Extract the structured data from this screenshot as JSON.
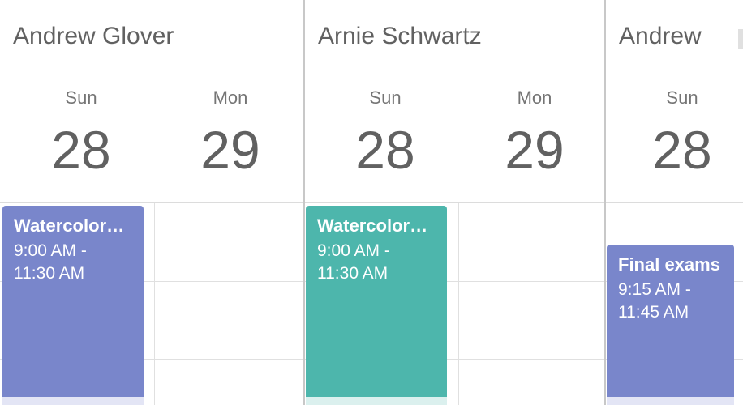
{
  "resources": [
    {
      "name": "Andrew Glover"
    },
    {
      "name": "Arnie Schwartz"
    },
    {
      "name": "Andrew"
    }
  ],
  "days": [
    {
      "day": "Sun",
      "date": "28"
    },
    {
      "day": "Mon",
      "date": "29"
    },
    {
      "day": "Sun",
      "date": "28"
    },
    {
      "day": "Mon",
      "date": "29"
    },
    {
      "day": "Sun",
      "date": "28"
    }
  ],
  "appointments": [
    {
      "title": "Watercolor…",
      "start": "9:00 AM  -",
      "end": "11:30 AM",
      "color": "#7986cb"
    },
    {
      "title": "Watercolor…",
      "start": "9:00 AM  -",
      "end": "11:30 AM",
      "color": "#4db6ac"
    },
    {
      "title": "Final exams",
      "start": "9:15 AM  -",
      "end": "11:45 AM",
      "color": "#7986cb"
    }
  ],
  "colors": {
    "accent_purple": "#7986cb",
    "accent_teal": "#4db6ac"
  }
}
